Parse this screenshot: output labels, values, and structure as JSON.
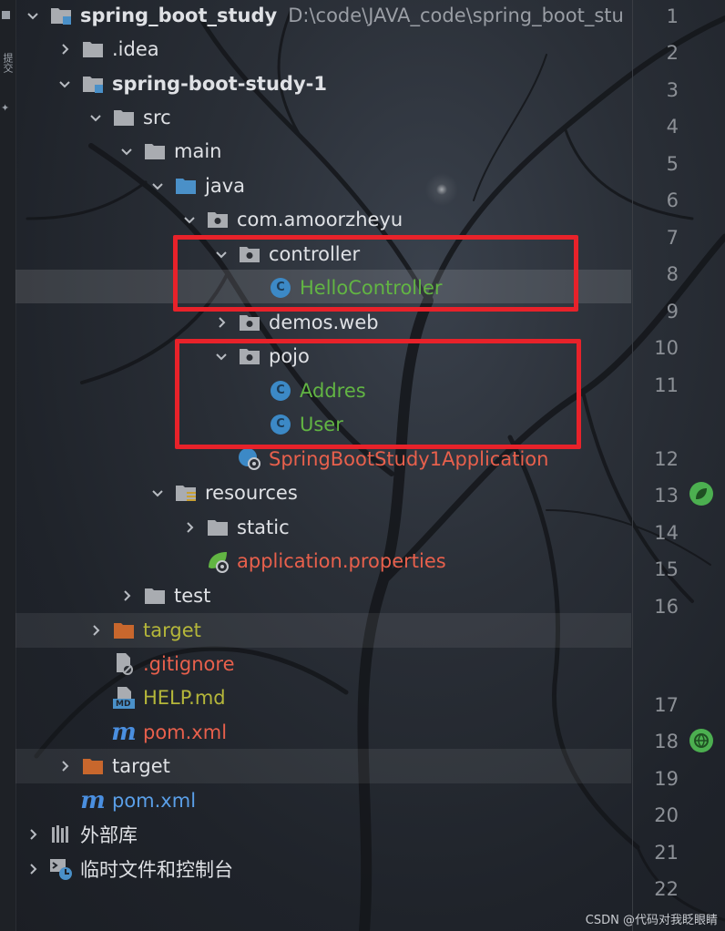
{
  "project": {
    "root_name": "spring_boot_study",
    "root_path": "D:\\code\\JAVA_code\\spring_boot_stu"
  },
  "tree": [
    {
      "label": ".idea"
    },
    {
      "label": "spring-boot-study-1"
    },
    {
      "label": "src"
    },
    {
      "label": "main"
    },
    {
      "label": "java"
    },
    {
      "label": "com.amoorzheyu"
    },
    {
      "label": "controller"
    },
    {
      "label": "HelloController"
    },
    {
      "label": "demos.web"
    },
    {
      "label": "pojo"
    },
    {
      "label": "Addres"
    },
    {
      "label": "User"
    },
    {
      "label": "SpringBootStudy1Application"
    },
    {
      "label": "resources"
    },
    {
      "label": "static"
    },
    {
      "label": "application.properties"
    },
    {
      "label": "test"
    },
    {
      "label": "target"
    },
    {
      "label": ".gitignore"
    },
    {
      "label": "HELP.md"
    },
    {
      "label": "pom.xml"
    },
    {
      "label": "target"
    },
    {
      "label": "pom.xml"
    },
    {
      "label": "外部库"
    },
    {
      "label": "临时文件和控制台"
    }
  ],
  "line_numbers": [
    "1",
    "2",
    "3",
    "4",
    "5",
    "6",
    "7",
    "8",
    "9",
    "10",
    "11",
    "12",
    "13",
    "14",
    "15",
    "16",
    "17",
    "18",
    "19",
    "20",
    "21",
    "22"
  ],
  "side_strip": {
    "label": "提交"
  },
  "class_icon_letter": "C",
  "md_icon_text": "MD",
  "maven_icon_text": "m",
  "watermark": "CSDN @代码对我眨眼睛",
  "colors": {
    "highlight_box": "#e8222a",
    "unversioned": "#e8604c",
    "added": "#62b543",
    "ignored": "#b5b73a",
    "folder": "#a9acb1",
    "source_folder": "#4a90c8",
    "excluded_folder": "#c8672d"
  }
}
